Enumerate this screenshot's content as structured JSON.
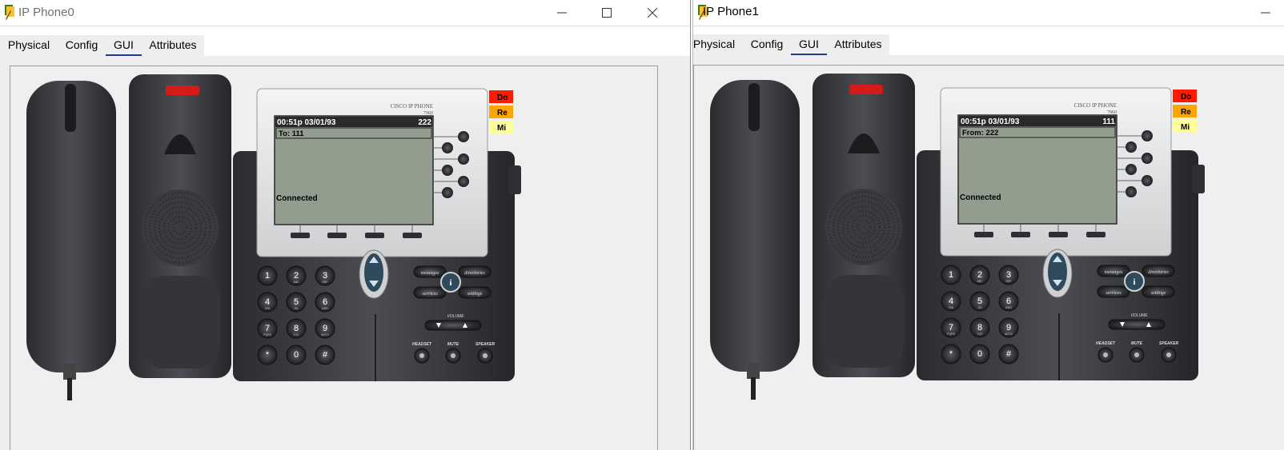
{
  "windows": [
    {
      "title": "IP Phone0",
      "tabs": [
        {
          "label": "Physical",
          "active": false
        },
        {
          "label": "Config",
          "active": false
        },
        {
          "label": "GUI",
          "active": true
        },
        {
          "label": "Attributes",
          "active": false
        }
      ],
      "phone": {
        "brand": "CISCO IP PHONE",
        "model": "7960",
        "screen": {
          "datetime": "00:51p 03/01/93",
          "extension": "222",
          "call_line": "To: 111",
          "status": "Connected"
        },
        "side_keys": [
          "Do",
          "Re",
          "Mi"
        ],
        "keypad": [
          {
            "digit": "1",
            "letters": ""
          },
          {
            "digit": "2",
            "letters": "ABC"
          },
          {
            "digit": "3",
            "letters": "DEF"
          },
          {
            "digit": "4",
            "letters": "GHI"
          },
          {
            "digit": "5",
            "letters": "JKL"
          },
          {
            "digit": "6",
            "letters": "MNO"
          },
          {
            "digit": "7",
            "letters": "PQRS"
          },
          {
            "digit": "8",
            "letters": "TUV"
          },
          {
            "digit": "9",
            "letters": "WXYZ"
          },
          {
            "digit": "*",
            "letters": ""
          },
          {
            "digit": "0",
            "letters": ""
          },
          {
            "digit": "#",
            "letters": ""
          }
        ],
        "buttons": {
          "messages": "messages",
          "directories": "directories",
          "services": "services",
          "settings": "settings",
          "info": "i",
          "volume": "VOLUME",
          "headset": "HEADSET",
          "mute": "MUTE",
          "speaker": "SPEAKER"
        }
      }
    },
    {
      "title": "IP Phone1",
      "tabs": [
        {
          "label": "Physical",
          "active": false
        },
        {
          "label": "Config",
          "active": false
        },
        {
          "label": "GUI",
          "active": true
        },
        {
          "label": "Attributes",
          "active": false
        }
      ],
      "phone": {
        "brand": "CISCO IP PHONE",
        "model": "7960",
        "screen": {
          "datetime": "00:51p 03/01/93",
          "extension": "111",
          "call_line": "From: 222",
          "status": "Connected"
        },
        "side_keys": [
          "Do",
          "Re",
          "Mi"
        ],
        "keypad": [
          {
            "digit": "1",
            "letters": ""
          },
          {
            "digit": "2",
            "letters": "ABC"
          },
          {
            "digit": "3",
            "letters": "DEF"
          },
          {
            "digit": "4",
            "letters": "GHI"
          },
          {
            "digit": "5",
            "letters": "JKL"
          },
          {
            "digit": "6",
            "letters": "MNO"
          },
          {
            "digit": "7",
            "letters": "PQRS"
          },
          {
            "digit": "8",
            "letters": "TUV"
          },
          {
            "digit": "9",
            "letters": "WXYZ"
          },
          {
            "digit": "*",
            "letters": ""
          },
          {
            "digit": "0",
            "letters": ""
          },
          {
            "digit": "#",
            "letters": ""
          }
        ],
        "buttons": {
          "messages": "messages",
          "directories": "directories",
          "services": "services",
          "settings": "settings",
          "info": "i",
          "volume": "VOLUME",
          "headset": "HEADSET",
          "mute": "MUTE",
          "speaker": "SPEAKER"
        }
      }
    }
  ],
  "colors": {
    "tab_underline": "#1f3c88",
    "lcd_bg": "#939d8e",
    "lcd_header": "#2a2a2a",
    "key_do": "#ff1a00",
    "key_re": "#ffa500",
    "key_mi": "#ffff99"
  }
}
